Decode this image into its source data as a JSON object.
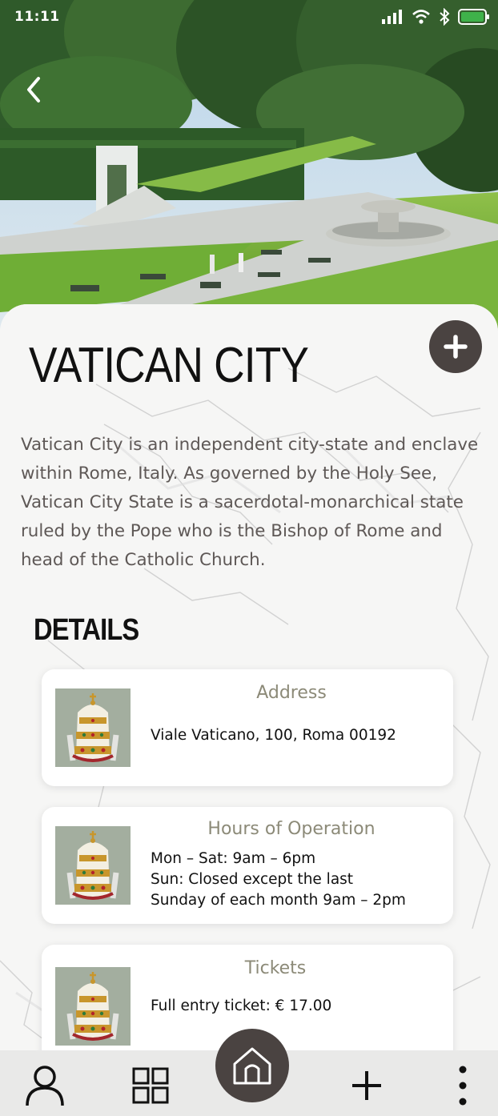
{
  "status_bar": {
    "time": "11:11"
  },
  "place": {
    "title": "VATICAN CITY",
    "description": "Vatican City is an independent city-state and enclave within Rome, Italy. As governed by the Holy See, Vatican City State is a sacerdotal-monarchical state ruled by the Pope who is the Bishop of Rome and head of the Catholic Church."
  },
  "details_heading": "DETAILS",
  "details": [
    {
      "title": "Address",
      "lines": [
        "Viale Vaticano, 100, Roma 00192"
      ]
    },
    {
      "title": "Hours of Operation",
      "lines": [
        "Mon – Sat: 9am – 6pm",
        "Sun: Closed except the last",
        "Sunday of each month 9am – 2pm"
      ]
    },
    {
      "title": "Tickets",
      "lines": [
        "Full entry ticket: € 17.00"
      ]
    }
  ],
  "icons": {
    "back": "chevron-left-icon",
    "add": "plus-icon",
    "thumb": "papal-tiara-icon",
    "nav": [
      "user-icon",
      "grid-icon",
      "home-icon",
      "plus-icon",
      "more-vertical-icon"
    ]
  },
  "colors": {
    "accent_dark": "#4a4341",
    "card_title": "#8c8a78",
    "body_text": "#5e5856"
  }
}
